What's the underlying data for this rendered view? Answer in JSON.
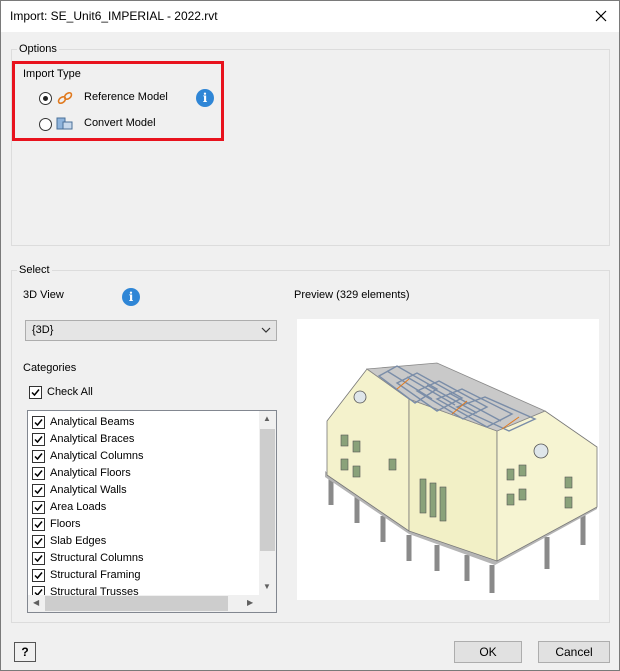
{
  "window": {
    "title": "Import:  SE_Unit6_IMPERIAL - 2022.rvt"
  },
  "options": {
    "group_label": "Options",
    "import_type_label": "Import Type",
    "radios": [
      {
        "label": "Reference Model",
        "selected": true,
        "icon": "link-icon"
      },
      {
        "label": "Convert Model",
        "selected": false,
        "icon": "convert-model-icon"
      }
    ],
    "highlight_color": "#e8121d"
  },
  "select": {
    "group_label": "Select",
    "view_label": "3D View",
    "view_value": "{3D}",
    "preview_label": "Preview (329 elements)",
    "categories_label": "Categories",
    "check_all_label": "Check All",
    "check_all_checked": true,
    "categories": [
      {
        "label": "Analytical Beams",
        "checked": true
      },
      {
        "label": "Analytical Braces",
        "checked": true
      },
      {
        "label": "Analytical Columns",
        "checked": true
      },
      {
        "label": "Analytical Floors",
        "checked": true
      },
      {
        "label": "Analytical Walls",
        "checked": true
      },
      {
        "label": "Area Loads",
        "checked": true
      },
      {
        "label": "Floors",
        "checked": true
      },
      {
        "label": "Slab Edges",
        "checked": true
      },
      {
        "label": "Structural Columns",
        "checked": true
      },
      {
        "label": "Structural Framing",
        "checked": true
      },
      {
        "label": "Structural Trusses",
        "checked": true
      }
    ]
  },
  "footer": {
    "help_label": "?",
    "ok_label": "OK",
    "cancel_label": "Cancel"
  },
  "colors": {
    "info_blue": "#2f86d6",
    "link_orange": "#e07a1f"
  }
}
